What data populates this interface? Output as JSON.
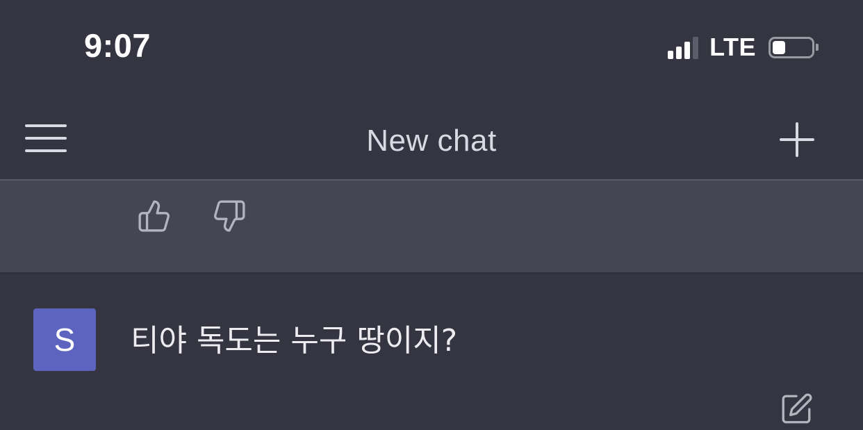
{
  "status_bar": {
    "time": "9:07",
    "network": "LTE",
    "signal_bars_filled": 3,
    "signal_bars_total": 4,
    "battery_level": 0.33
  },
  "header": {
    "title": "New chat",
    "menu_icon": "hamburger-menu-icon",
    "new_chat_icon": "plus-icon"
  },
  "assistant_message": {
    "feedback": {
      "thumbs_up_icon": "thumbs-up-icon",
      "thumbs_down_icon": "thumbs-down-icon"
    }
  },
  "user_message": {
    "avatar_letter": "S",
    "text": "티야 독도는 누구 땅이지?",
    "edit_icon": "edit-icon"
  },
  "colors": {
    "background": "#343541",
    "assistant_band": "#444654",
    "avatar": "#5d64c0",
    "text": "#ececf1"
  }
}
